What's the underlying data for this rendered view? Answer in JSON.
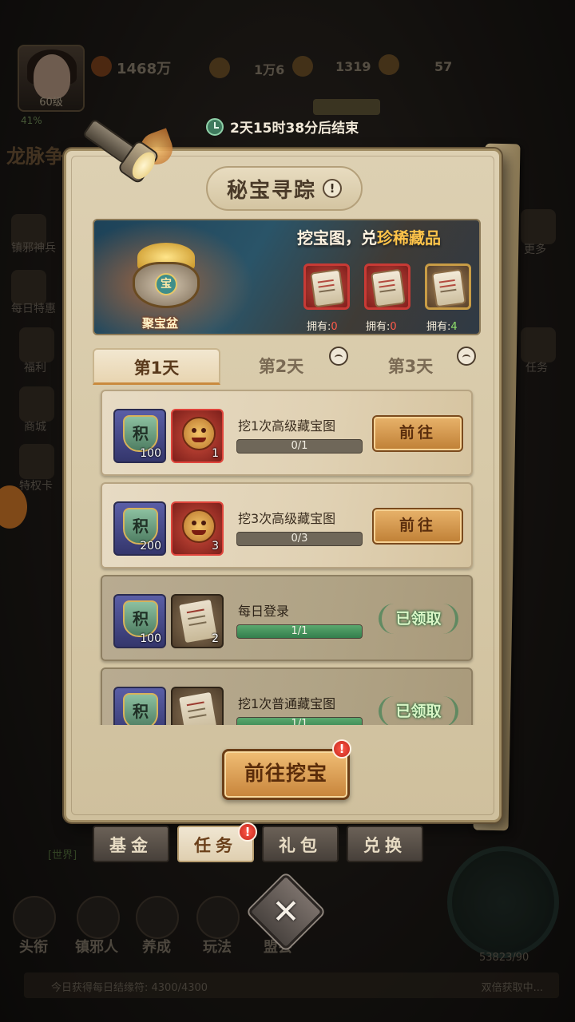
{
  "background": {
    "player_power": "1468万",
    "player_level": "60级",
    "player_exp": "41%",
    "resource_1": "1万6",
    "resource_2": "1319",
    "resource_3": "57",
    "event_title": "龙脉争",
    "side_labels": [
      "镇邪神兵",
      "每日特惠",
      "福利",
      "商城",
      "特权卡",
      "更多",
      "任务"
    ],
    "chat": "[世界]",
    "nav": [
      "头衔",
      "镇邪人",
      "养成",
      "玩法",
      "盟会"
    ],
    "daily_counter": "今日获得每日结缘符: 4300/4300",
    "daily_right": "双倍获取中...",
    "currency_counter": "53823/90"
  },
  "timer": {
    "text": "2天15时38分后结束",
    "icon": "clock-icon"
  },
  "panel": {
    "title": "秘宝寻踪",
    "info_icon": "!",
    "banner": {
      "slogan_prefix": "挖宝图，兑",
      "slogan_highlight": "珍稀藏品",
      "pot_label": "聚宝盆",
      "pot_coin": "宝",
      "maps": [
        {
          "owned_label": "拥有:",
          "count": "0"
        },
        {
          "owned_label": "拥有:",
          "count": "0"
        },
        {
          "owned_label": "拥有:",
          "count": "4"
        }
      ]
    },
    "tabs": [
      "第1天",
      "第2天",
      "第3天"
    ],
    "tasks": [
      {
        "name": "挖1次高级藏宝图",
        "points": "100",
        "item_qty": "1",
        "progress": "0/1",
        "progress_value": 0,
        "action": "前往",
        "ji": "积"
      },
      {
        "name": "挖3次高级藏宝图",
        "points": "200",
        "item_qty": "3",
        "progress": "0/3",
        "progress_value": 0,
        "action": "前往",
        "ji": "积"
      },
      {
        "name": "每日登录",
        "points": "100",
        "item_qty": "2",
        "progress": "1/1",
        "progress_value": 1,
        "action": "已领取",
        "ji": "积"
      },
      {
        "name": "挖1次普通藏宝图",
        "points": "",
        "item_qty": "",
        "progress": "1/1",
        "progress_value": 1,
        "action": "已领取",
        "ji": "积"
      }
    ],
    "main_button": "前往挖宝",
    "alert": "!"
  },
  "bottom_tabs": [
    "基金",
    "任务",
    "礼包",
    "兑换"
  ],
  "close_button": "✕",
  "colors": {
    "accent": "#c7843a",
    "progress_fill": "#337e4c",
    "highlight": "#ffc44a"
  }
}
